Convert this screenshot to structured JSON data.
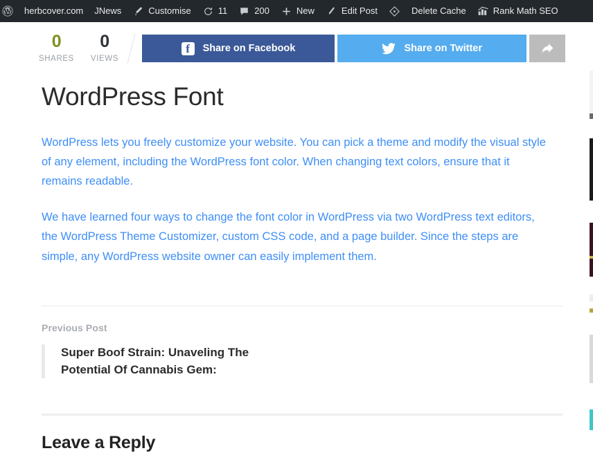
{
  "admin_bar": {
    "items": [
      {
        "icon": "wordpress-logo-icon",
        "label": ""
      },
      {
        "icon": "",
        "label": "herbcover.com"
      },
      {
        "icon": "",
        "label": "JNews"
      },
      {
        "icon": "paintbrush-icon",
        "label": "Customise"
      },
      {
        "icon": "updates-icon",
        "label": "11"
      },
      {
        "icon": "comment-bubble-icon",
        "label": "200"
      },
      {
        "icon": "plus-icon",
        "label": "New"
      },
      {
        "icon": "pencil-icon",
        "label": "Edit Post"
      },
      {
        "icon": "diamond-cache-icon",
        "label": ""
      },
      {
        "icon": "",
        "label": "Delete Cache"
      },
      {
        "icon": "rank-math-icon",
        "label": "Rank Math SEO"
      }
    ]
  },
  "share_bar": {
    "shares_count": "0",
    "shares_label": "SHARES",
    "views_count": "0",
    "views_label": "VIEWS",
    "facebook_label": "Share on Facebook",
    "facebook_glyph": "f",
    "twitter_label": "Share on Twitter",
    "more_icon": "share-arrow-icon",
    "colors": {
      "facebook": "#3b5998",
      "twitter": "#55acee",
      "more": "#bcbcbc",
      "shares_number": "#7e9021",
      "views_number": "#2f3337"
    }
  },
  "article": {
    "title": "WordPress Font",
    "paragraphs": [
      "WordPress lets you freely customize your website. You can pick a theme and modify the visual style of any element, including the WordPress font color. When changing text colors, ensure that it remains readable.",
      "We have learned four ways to change the font color in WordPress via two WordPress text editors, the WordPress Theme Customizer, custom CSS code, and a page builder. Since the steps are simple, any WordPress website owner can easily implement them."
    ],
    "paragraph_color": "#3e8ef7"
  },
  "previous_post": {
    "label": "Previous Post",
    "title": "Super Boof Strain: Unaveling The Potential Of Cannabis Gem:"
  },
  "comments": {
    "heading": "Leave a Reply"
  }
}
